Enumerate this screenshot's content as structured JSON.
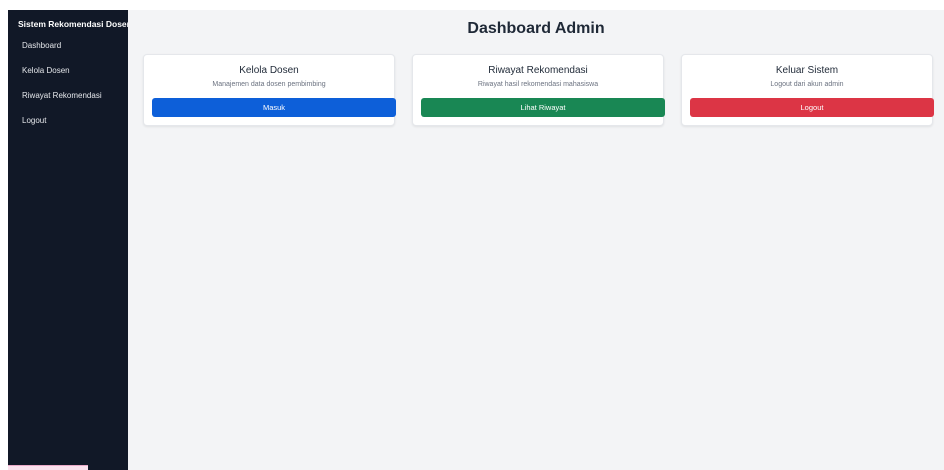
{
  "sidebar": {
    "title": "Sistem Rekomendasi Dosen",
    "items": [
      {
        "label": "Dashboard"
      },
      {
        "label": "Kelola Dosen"
      },
      {
        "label": "Riwayat Rekomendasi"
      },
      {
        "label": "Logout"
      }
    ]
  },
  "main": {
    "title": "Dashboard Admin",
    "cards": [
      {
        "title": "Kelola Dosen",
        "desc": "Manajemen data dosen pembimbing",
        "button": "Masuk",
        "color": "#0d5fd9"
      },
      {
        "title": "Riwayat Rekomendasi",
        "desc": "Riwayat hasil rekomendasi mahasiswa",
        "button": "Lihat Riwayat",
        "color": "#198754"
      },
      {
        "title": "Keluar Sistem",
        "desc": "Logout dari akun admin",
        "button": "Logout",
        "color": "#dc3545"
      }
    ]
  }
}
